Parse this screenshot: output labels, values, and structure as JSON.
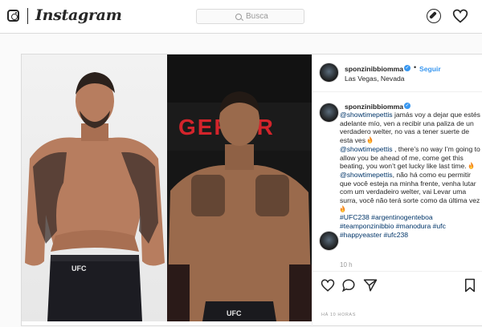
{
  "header": {
    "wordmark": "Instagram",
    "search_placeholder": "Busca",
    "icons": [
      "instagram-logo-icon",
      "explore-compass-icon",
      "activity-heart-icon"
    ]
  },
  "post": {
    "username": "sponzinibbiomma",
    "follow_label": "Seguir",
    "location": "Las Vegas, Nevada",
    "caption": {
      "username": "sponzinibbiomma",
      "es_mention": "@showtimepettis",
      "es_text": " jamás voy a dejar que estés adelante mío, ven a recibir una paliza de un verdadero welter, no vas a tener suerte de esta ves ",
      "en_mention": "@showtimepettis",
      "en_text": " , there’s no way I’m going to allow you be ahead of me, come get this beating, you won’t get lucky like last time. ",
      "pt_mention": "@showtimepettis",
      "pt_text": ", não há como eu permitir que você esteja na minha frente, venha lutar com um verdadeiro welter, vai Levar uma surra, você não terá sorte como da última vez ",
      "hashtags_line1": "#UFC238 #argentinogenteboa",
      "hashtags_line2": "#teamponzinibbio #manodura #ufc",
      "hashtags_line3": "#happyeaster #ufc238"
    },
    "time_ago": "10 h",
    "timestamp": "HÁ 10 HORAS",
    "colors": {
      "link": "#003569",
      "follow": "#3897f0",
      "verified": "#3897f0"
    },
    "media": {
      "left_shorts_text": "UFC",
      "right_banner_text": "GER AR",
      "right_shorts_text": "UFC"
    }
  }
}
